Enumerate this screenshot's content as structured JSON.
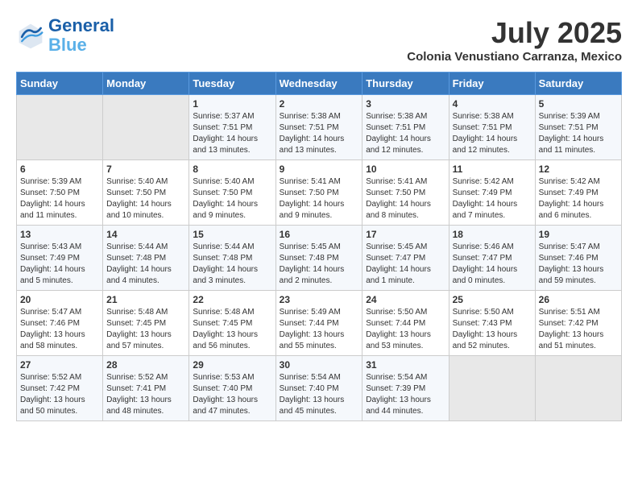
{
  "header": {
    "logo_line1": "General",
    "logo_line2": "Blue",
    "month_year": "July 2025",
    "location": "Colonia Venustiano Carranza, Mexico"
  },
  "days_of_week": [
    "Sunday",
    "Monday",
    "Tuesday",
    "Wednesday",
    "Thursday",
    "Friday",
    "Saturday"
  ],
  "weeks": [
    [
      {
        "day": "",
        "info": ""
      },
      {
        "day": "",
        "info": ""
      },
      {
        "day": "1",
        "info": "Sunrise: 5:37 AM\nSunset: 7:51 PM\nDaylight: 14 hours and 13 minutes."
      },
      {
        "day": "2",
        "info": "Sunrise: 5:38 AM\nSunset: 7:51 PM\nDaylight: 14 hours and 13 minutes."
      },
      {
        "day": "3",
        "info": "Sunrise: 5:38 AM\nSunset: 7:51 PM\nDaylight: 14 hours and 12 minutes."
      },
      {
        "day": "4",
        "info": "Sunrise: 5:38 AM\nSunset: 7:51 PM\nDaylight: 14 hours and 12 minutes."
      },
      {
        "day": "5",
        "info": "Sunrise: 5:39 AM\nSunset: 7:51 PM\nDaylight: 14 hours and 11 minutes."
      }
    ],
    [
      {
        "day": "6",
        "info": "Sunrise: 5:39 AM\nSunset: 7:50 PM\nDaylight: 14 hours and 11 minutes."
      },
      {
        "day": "7",
        "info": "Sunrise: 5:40 AM\nSunset: 7:50 PM\nDaylight: 14 hours and 10 minutes."
      },
      {
        "day": "8",
        "info": "Sunrise: 5:40 AM\nSunset: 7:50 PM\nDaylight: 14 hours and 9 minutes."
      },
      {
        "day": "9",
        "info": "Sunrise: 5:41 AM\nSunset: 7:50 PM\nDaylight: 14 hours and 9 minutes."
      },
      {
        "day": "10",
        "info": "Sunrise: 5:41 AM\nSunset: 7:50 PM\nDaylight: 14 hours and 8 minutes."
      },
      {
        "day": "11",
        "info": "Sunrise: 5:42 AM\nSunset: 7:49 PM\nDaylight: 14 hours and 7 minutes."
      },
      {
        "day": "12",
        "info": "Sunrise: 5:42 AM\nSunset: 7:49 PM\nDaylight: 14 hours and 6 minutes."
      }
    ],
    [
      {
        "day": "13",
        "info": "Sunrise: 5:43 AM\nSunset: 7:49 PM\nDaylight: 14 hours and 5 minutes."
      },
      {
        "day": "14",
        "info": "Sunrise: 5:44 AM\nSunset: 7:48 PM\nDaylight: 14 hours and 4 minutes."
      },
      {
        "day": "15",
        "info": "Sunrise: 5:44 AM\nSunset: 7:48 PM\nDaylight: 14 hours and 3 minutes."
      },
      {
        "day": "16",
        "info": "Sunrise: 5:45 AM\nSunset: 7:48 PM\nDaylight: 14 hours and 2 minutes."
      },
      {
        "day": "17",
        "info": "Sunrise: 5:45 AM\nSunset: 7:47 PM\nDaylight: 14 hours and 1 minute."
      },
      {
        "day": "18",
        "info": "Sunrise: 5:46 AM\nSunset: 7:47 PM\nDaylight: 14 hours and 0 minutes."
      },
      {
        "day": "19",
        "info": "Sunrise: 5:47 AM\nSunset: 7:46 PM\nDaylight: 13 hours and 59 minutes."
      }
    ],
    [
      {
        "day": "20",
        "info": "Sunrise: 5:47 AM\nSunset: 7:46 PM\nDaylight: 13 hours and 58 minutes."
      },
      {
        "day": "21",
        "info": "Sunrise: 5:48 AM\nSunset: 7:45 PM\nDaylight: 13 hours and 57 minutes."
      },
      {
        "day": "22",
        "info": "Sunrise: 5:48 AM\nSunset: 7:45 PM\nDaylight: 13 hours and 56 minutes."
      },
      {
        "day": "23",
        "info": "Sunrise: 5:49 AM\nSunset: 7:44 PM\nDaylight: 13 hours and 55 minutes."
      },
      {
        "day": "24",
        "info": "Sunrise: 5:50 AM\nSunset: 7:44 PM\nDaylight: 13 hours and 53 minutes."
      },
      {
        "day": "25",
        "info": "Sunrise: 5:50 AM\nSunset: 7:43 PM\nDaylight: 13 hours and 52 minutes."
      },
      {
        "day": "26",
        "info": "Sunrise: 5:51 AM\nSunset: 7:42 PM\nDaylight: 13 hours and 51 minutes."
      }
    ],
    [
      {
        "day": "27",
        "info": "Sunrise: 5:52 AM\nSunset: 7:42 PM\nDaylight: 13 hours and 50 minutes."
      },
      {
        "day": "28",
        "info": "Sunrise: 5:52 AM\nSunset: 7:41 PM\nDaylight: 13 hours and 48 minutes."
      },
      {
        "day": "29",
        "info": "Sunrise: 5:53 AM\nSunset: 7:40 PM\nDaylight: 13 hours and 47 minutes."
      },
      {
        "day": "30",
        "info": "Sunrise: 5:54 AM\nSunset: 7:40 PM\nDaylight: 13 hours and 45 minutes."
      },
      {
        "day": "31",
        "info": "Sunrise: 5:54 AM\nSunset: 7:39 PM\nDaylight: 13 hours and 44 minutes."
      },
      {
        "day": "",
        "info": ""
      },
      {
        "day": "",
        "info": ""
      }
    ]
  ]
}
